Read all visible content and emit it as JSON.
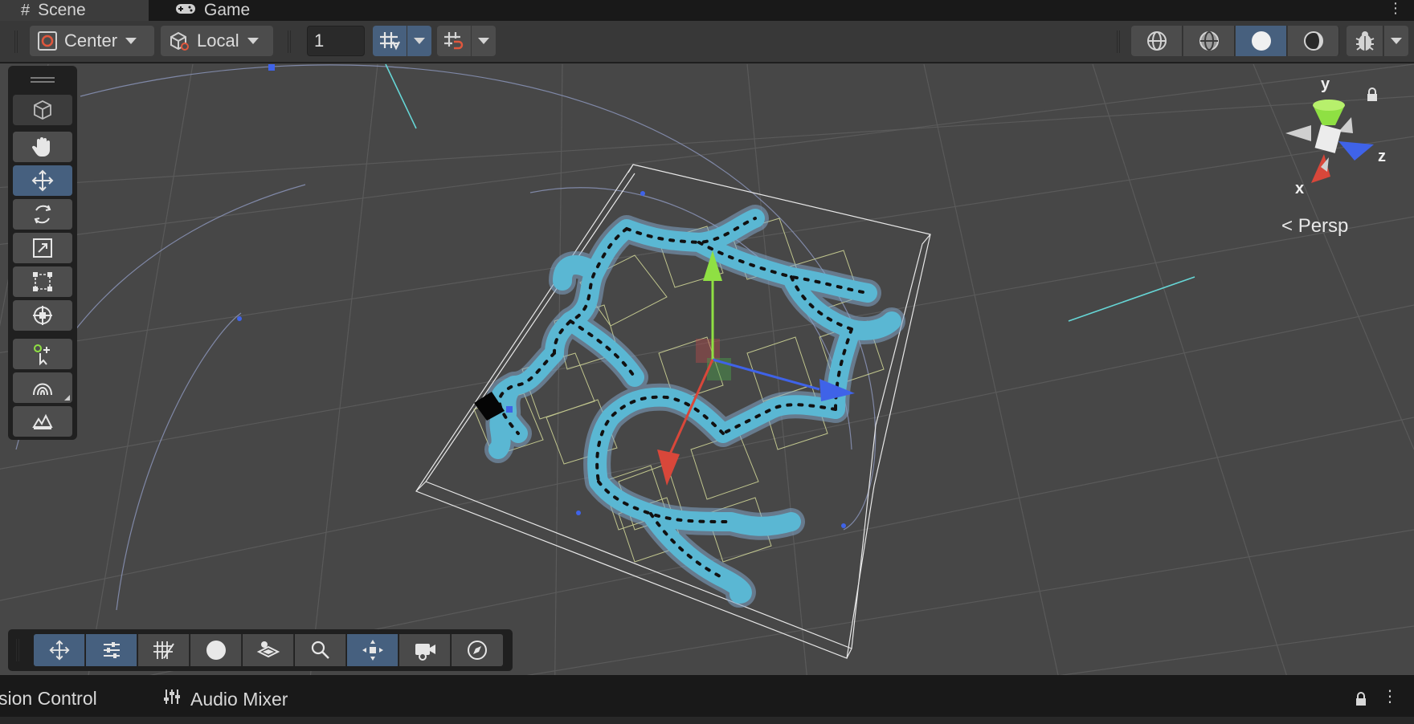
{
  "tabs": {
    "scene_label": "Scene",
    "game_label": "Game",
    "menu_glyph": "⋮"
  },
  "toolbar": {
    "pivot_mode": "Center",
    "pivot_rotation": "Local",
    "snap_increment": "1",
    "accent_color": "#47607e"
  },
  "viewport": {
    "projection_label": "Persp",
    "axis_labels": {
      "x": "x",
      "y": "y",
      "z": "z"
    },
    "axis_colors": {
      "x": "#d9473a",
      "y": "#8fe043",
      "z": "#3f63e8"
    }
  },
  "tool_palette": [
    "view-tool-icon",
    "hand-tool-icon",
    "move-tool-icon",
    "rotate-tool-icon",
    "scale-tool-icon",
    "rect-tool-icon",
    "transform-tool-icon",
    "add-point-tool-icon",
    "spline-tool-icon",
    "terrain-tool-icon"
  ],
  "overlay_toolbar": [
    "move-handles-icon",
    "tool-settings-icon",
    "grid-snapping-icon",
    "shading-sphere-icon",
    "layers-icon",
    "search-icon",
    "orientation-icon",
    "camera-icon",
    "navigation-icon"
  ],
  "bottom_tabs": {
    "version_control_label": "sion Control",
    "audio_mixer_label": "Audio Mixer",
    "menu_glyph": "⋮"
  }
}
